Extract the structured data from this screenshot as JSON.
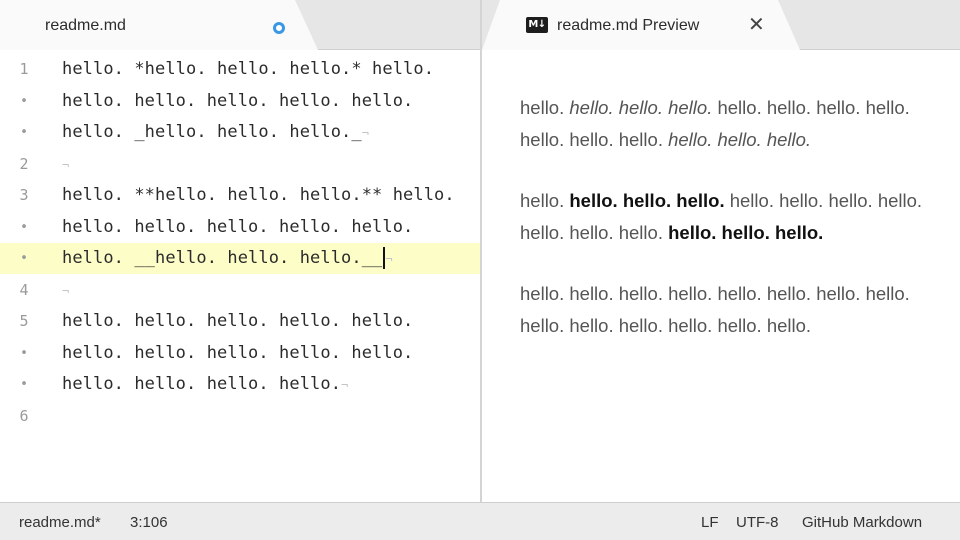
{
  "editor": {
    "tab_title": "readme.md",
    "lines": [
      {
        "gutter": "1",
        "text": "hello. *hello. hello. hello.* hello.",
        "eol": "",
        "current": false
      },
      {
        "gutter": "•",
        "text": "hello. hello. hello. hello. hello.",
        "eol": "",
        "current": false
      },
      {
        "gutter": "•",
        "text": "hello. _hello. hello. hello._",
        "eol": "¬",
        "current": false
      },
      {
        "gutter": "2",
        "text": "",
        "eol": "¬",
        "current": false
      },
      {
        "gutter": "3",
        "text": "hello. **hello. hello. hello.** hello.",
        "eol": "",
        "current": false
      },
      {
        "gutter": "•",
        "text": "hello. hello. hello. hello. hello.",
        "eol": "",
        "current": false
      },
      {
        "gutter": "•",
        "text": "hello. __hello. hello. hello.__",
        "eol": "¬",
        "current": true
      },
      {
        "gutter": "4",
        "text": "",
        "eol": "¬",
        "current": false
      },
      {
        "gutter": "5",
        "text": "hello. hello. hello. hello. hello.",
        "eol": "",
        "current": false
      },
      {
        "gutter": "•",
        "text": "hello. hello. hello. hello. hello.",
        "eol": "",
        "current": false
      },
      {
        "gutter": "•",
        "text": "hello. hello. hello. hello.",
        "eol": "¬",
        "current": false
      },
      {
        "gutter": "6",
        "text": "",
        "eol": "",
        "current": false
      }
    ]
  },
  "preview": {
    "tab_title": "readme.md Preview",
    "md_badge": "M↓",
    "close_glyph": "✕",
    "paragraphs": [
      [
        {
          "t": "hello. ",
          "s": "normal"
        },
        {
          "t": "hello. hello. hello.",
          "s": "italic"
        },
        {
          "t": " hello. hello. hello. hello. hello. hello. hello. ",
          "s": "normal"
        },
        {
          "t": "hello. hello. hello.",
          "s": "italic"
        }
      ],
      [
        {
          "t": "hello. ",
          "s": "normal"
        },
        {
          "t": "hello. hello. hello.",
          "s": "bold"
        },
        {
          "t": " hello. hello. hello. hello. hello. hello. hello. ",
          "s": "normal"
        },
        {
          "t": "hello. hello. hello.",
          "s": "bold"
        }
      ],
      [
        {
          "t": "hello. hello. hello. hello. hello. hello. hello. hello. hello. hello. hello. hello. hello. hello.",
          "s": "normal"
        }
      ]
    ]
  },
  "statusbar": {
    "file": "readme.md*",
    "position": "3:106",
    "line_ending": "LF",
    "encoding": "UTF-8",
    "grammar": "GitHub Markdown"
  },
  "colors": {
    "modified_dot": "#3b97e3",
    "current_line": "#fdfdc8"
  }
}
